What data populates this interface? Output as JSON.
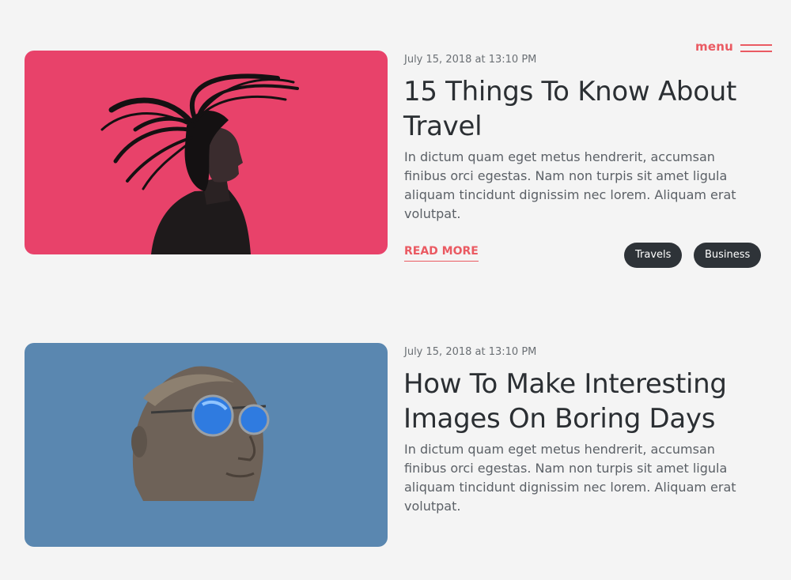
{
  "header": {
    "menu_label": "menu"
  },
  "posts": [
    {
      "date": "July 15, 2018 at 13:10 PM",
      "title": "15 Things To Know About Travel",
      "excerpt": "In dictum quam eget metus hendrerit, accumsan finibus orci egestas. Nam non turpis sit amet ligula aliquam tincidunt dignissim nec lorem. Aliquam erat volutpat.",
      "read_more": "READ MORE",
      "tags": [
        "Travels",
        "Business"
      ]
    },
    {
      "date": "July 15, 2018 at 13:10 PM",
      "title": "How To Make Interesting Images On Boring Days",
      "excerpt": "In dictum quam eget metus hendrerit, accumsan finibus orci egestas. Nam non turpis sit amet ligula aliquam tincidunt dignissim nec lorem. Aliquam erat volutpat."
    }
  ],
  "colors": {
    "accent": "#ea5a62",
    "tag_bg": "#2e3338",
    "post1_image_bg": "#e8426a",
    "post2_image_bg": "#5a87b0"
  }
}
